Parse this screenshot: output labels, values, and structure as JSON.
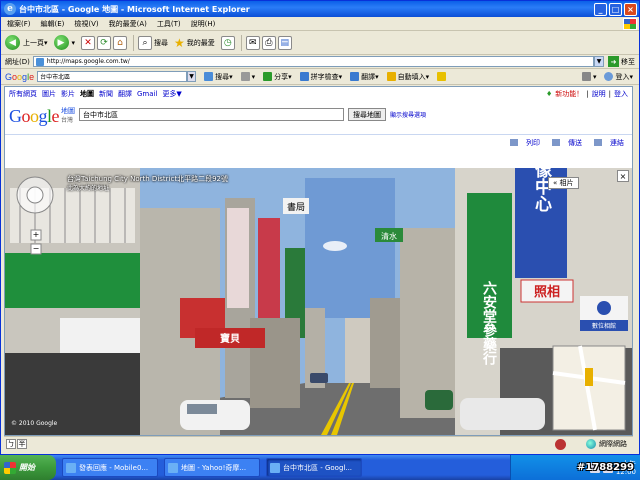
{
  "window": {
    "title": "台中市北區 - Google 地圖 - Microsoft Internet Explorer"
  },
  "menu": [
    "檔案(F)",
    "編輯(E)",
    "檢視(V)",
    "我的最愛(A)",
    "工具(T)",
    "說明(H)"
  ],
  "toolbar": {
    "back": "上一頁",
    "search": "搜尋",
    "favorites": "我的最愛"
  },
  "address": {
    "label": "網址(D)",
    "url": "http://maps.google.com.tw/",
    "go": "移至"
  },
  "google_toolbar": {
    "query": "台中市北區",
    "search": "搜尋",
    "share": "分享",
    "spellcheck": "拼字檢查",
    "translate": "翻譯",
    "autofill": "自動填入",
    "login": "登入"
  },
  "gbar": {
    "links": [
      "所有網頁",
      "圖片",
      "影片",
      "地圖",
      "新聞",
      "翻譯",
      "Gmail",
      "更多▼"
    ],
    "new_feature": "新功能！",
    "help": "說明",
    "login": "登入"
  },
  "maps": {
    "logo_sub": "地圖",
    "region": "台灣",
    "query": "台中市北區",
    "search_button": "搜尋地圖",
    "options": "顯示搜尋選項",
    "print": "列印",
    "send": "傳送",
    "link": "連結"
  },
  "streetview": {
    "address": "台灣Taichung City North  District北平路二段92號",
    "address_sub": "此為大約的地址",
    "photos": "« 相片",
    "copyright": "© 2010 Google"
  },
  "shop_signs": {
    "sign_left": "書局",
    "pharmacy": "六安堂參藥行",
    "photo_center": "影像中心",
    "photo_sign": "照相",
    "konica": "數位相館",
    "shop_red": "寶貝",
    "small_green": "清水"
  },
  "status": {
    "ime1": "ㄅ",
    "ime2": "半",
    "zone": "網際網路"
  },
  "taskbar": {
    "start": "開始",
    "tasks": [
      "發表回應 - Mobile0...",
      "地圖 - Yahoo!奇摩...",
      "台中市北區 - Googl..."
    ],
    "clock_line1": "上午",
    "clock_line2": "12:00"
  },
  "watermark": "#1788299"
}
